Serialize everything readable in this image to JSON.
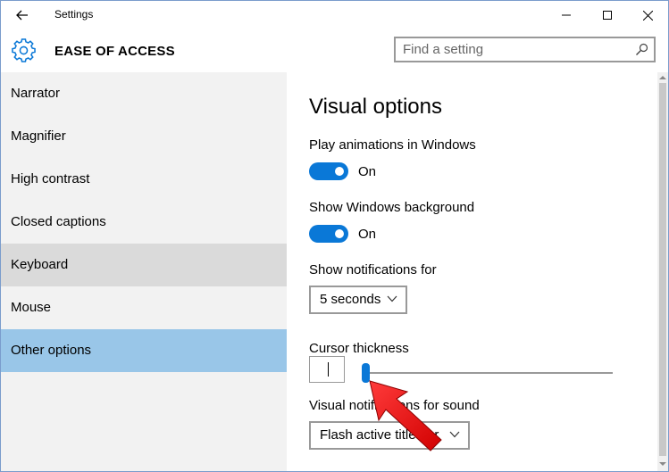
{
  "window": {
    "title": "Settings",
    "accent_color": "#0a78d7",
    "selected_color": "#99c6e8"
  },
  "header": {
    "title": "EASE OF ACCESS",
    "icon": "gear-icon",
    "search": {
      "placeholder": "Find a setting",
      "value": ""
    }
  },
  "sidebar": {
    "items": [
      {
        "label": "Narrator",
        "state": "normal"
      },
      {
        "label": "Magnifier",
        "state": "normal"
      },
      {
        "label": "High contrast",
        "state": "normal"
      },
      {
        "label": "Closed captions",
        "state": "normal"
      },
      {
        "label": "Keyboard",
        "state": "hover"
      },
      {
        "label": "Mouse",
        "state": "normal"
      },
      {
        "label": "Other options",
        "state": "selected"
      }
    ]
  },
  "content": {
    "section_title": "Visual options",
    "animations": {
      "label": "Play animations in Windows",
      "toggle": "On"
    },
    "background": {
      "label": "Show Windows background",
      "toggle": "On"
    },
    "notifications": {
      "label": "Show notifications for",
      "selected": "5 seconds"
    },
    "cursor": {
      "label": "Cursor thickness",
      "value": 1
    },
    "sound": {
      "label": "Visual notifications for sound",
      "selected": "Flash active title bar"
    }
  }
}
